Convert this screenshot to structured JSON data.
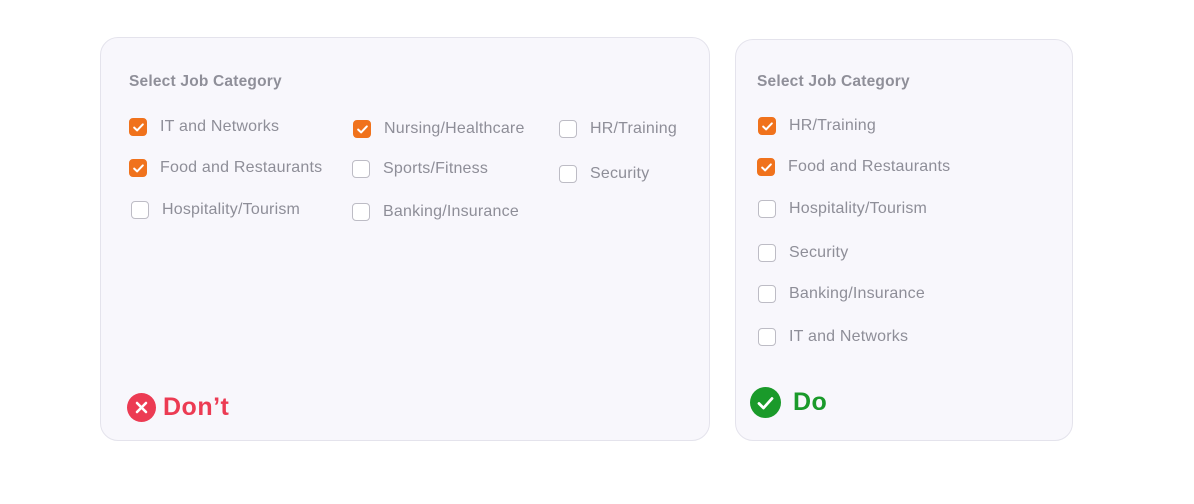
{
  "colors": {
    "checked": "#f0721c",
    "dont": "#ec3b53",
    "do": "#1a9a2a",
    "card_bg": "#f8f7fc",
    "label": "#8e8e98"
  },
  "dont_card": {
    "title": "Select Job Category",
    "options": [
      {
        "label": "IT and Networks",
        "checked": true
      },
      {
        "label": "Food and Restaurants",
        "checked": true
      },
      {
        "label": "Hospitality/Tourism",
        "checked": false
      },
      {
        "label": "Nursing/Healthcare",
        "checked": true
      },
      {
        "label": "Sports/Fitness",
        "checked": false
      },
      {
        "label": "Banking/Insurance",
        "checked": false
      },
      {
        "label": "HR/Training",
        "checked": false
      },
      {
        "label": "Security",
        "checked": false
      }
    ],
    "verdict": {
      "icon": "x-circle-icon",
      "label": "Don’t"
    }
  },
  "do_card": {
    "title": "Select Job Category",
    "options": [
      {
        "label": "HR/Training",
        "checked": true
      },
      {
        "label": "Food and Restaurants",
        "checked": true
      },
      {
        "label": "Hospitality/Tourism",
        "checked": false
      },
      {
        "label": "Security",
        "checked": false
      },
      {
        "label": "Banking/Insurance",
        "checked": false
      },
      {
        "label": "IT and Networks",
        "checked": false
      }
    ],
    "verdict": {
      "icon": "check-circle-icon",
      "label": "Do"
    }
  }
}
